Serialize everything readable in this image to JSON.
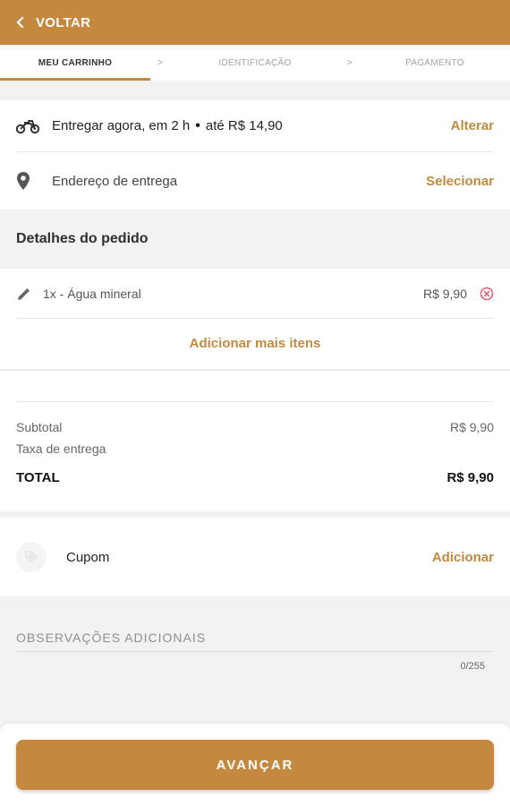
{
  "header": {
    "back_label": "VOLTAR"
  },
  "steps": [
    {
      "label": "MEU CARRINHO",
      "active": true
    },
    {
      "label": "IDENTIFICAÇÃO",
      "active": false
    },
    {
      "label": "PAGAMENTO",
      "active": false
    }
  ],
  "step_separator": ">",
  "delivery": {
    "text": "Entregar agora, em 2 h",
    "price_text": "até R$ 14,90",
    "action": "Alterar"
  },
  "address": {
    "text": "Endereço de entrega",
    "action": "Selecionar"
  },
  "order_details": {
    "title": "Detalhes do pedido",
    "items": [
      {
        "text": "1x - Água mineral",
        "price": "R$ 9,90"
      }
    ],
    "add_more": "Adicionar mais itens"
  },
  "summary": {
    "subtotal_label": "Subtotal",
    "subtotal_value": "R$ 9,90",
    "delivery_fee_label": "Taxa de entrega",
    "total_label": "TOTAL",
    "total_value": "R$ 9,90"
  },
  "coupon": {
    "label": "Cupom",
    "action": "Adicionar"
  },
  "observations": {
    "label": "OBSERVAÇÕES ADICIONAIS",
    "counter": "0/255"
  },
  "footer": {
    "button_label": "AVANÇAR"
  },
  "colors": {
    "accent": "#c4893f",
    "remove": "#e05a6a",
    "background": "#f2f2f2"
  }
}
